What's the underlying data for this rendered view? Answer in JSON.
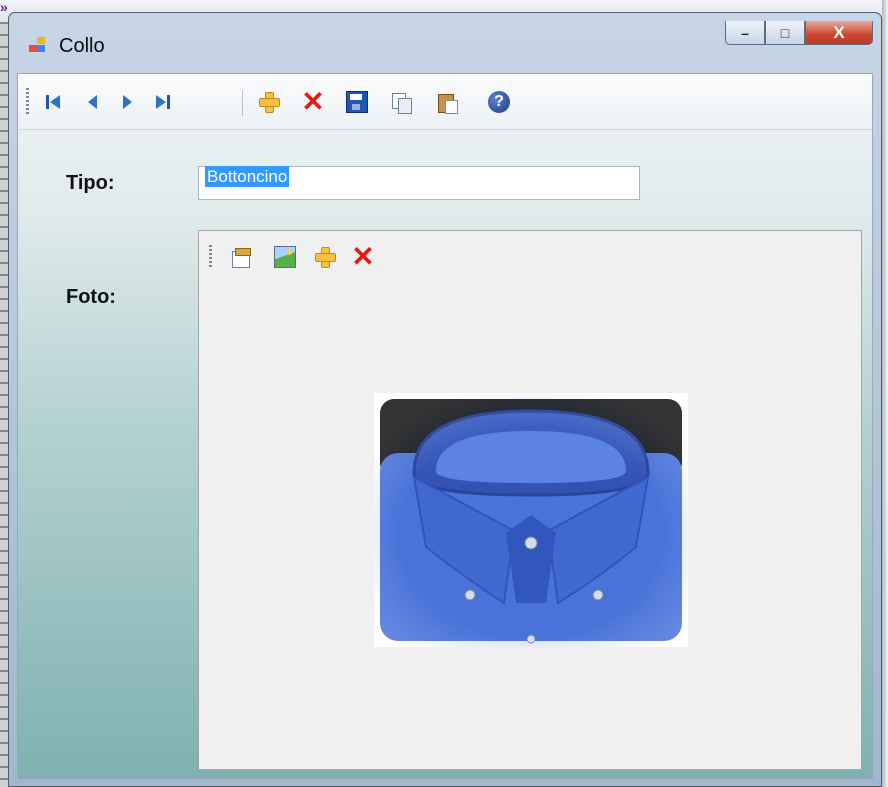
{
  "window": {
    "title": "Collo",
    "caption_buttons": {
      "minimize": "–",
      "maximize": "□",
      "close": "X"
    }
  },
  "toolbar": {
    "items": [
      {
        "name": "move-first-button",
        "icon": "first-record-icon"
      },
      {
        "name": "move-previous-button",
        "icon": "previous-record-icon"
      },
      {
        "name": "move-next-button",
        "icon": "next-record-icon"
      },
      {
        "name": "move-last-button",
        "icon": "last-record-icon"
      },
      {
        "name": "add-new-button",
        "icon": "plus-icon"
      },
      {
        "name": "delete-button",
        "icon": "delete-x-icon"
      },
      {
        "name": "save-button",
        "icon": "floppy-disk-icon"
      },
      {
        "name": "copy-button",
        "icon": "copy-icon"
      },
      {
        "name": "paste-button",
        "icon": "paste-icon"
      },
      {
        "name": "help-button",
        "icon": "help-icon"
      }
    ]
  },
  "form": {
    "tipo_label": "Tipo:",
    "tipo_value": "Bottoncino",
    "foto_label": "Foto:"
  },
  "photo_toolbar": {
    "items": [
      {
        "name": "properties-button",
        "icon": "properties-icon"
      },
      {
        "name": "load-image-button",
        "icon": "image-icon"
      },
      {
        "name": "add-image-button",
        "icon": "plus-icon"
      },
      {
        "name": "remove-image-button",
        "icon": "delete-x-icon"
      }
    ]
  },
  "photo": {
    "subject": "blue-shirt-collar-image",
    "dominant_color": "#3f6ee0"
  },
  "colors": {
    "accent": "#3399ff",
    "close": "#c9452f",
    "plus": "#f7c23a",
    "delete": "#e21b13"
  }
}
